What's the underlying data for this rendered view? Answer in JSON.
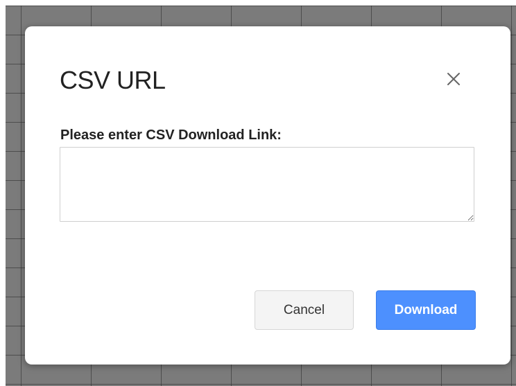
{
  "dialog": {
    "title": "CSV URL",
    "field_label": "Please enter CSV Download Link:",
    "input_value": "",
    "cancel_label": "Cancel",
    "download_label": "Download",
    "close_icon": "close-icon"
  },
  "colors": {
    "primary_button": "#4d90fe",
    "secondary_button": "#f4f4f4",
    "backdrop": "#7b7b7b"
  }
}
